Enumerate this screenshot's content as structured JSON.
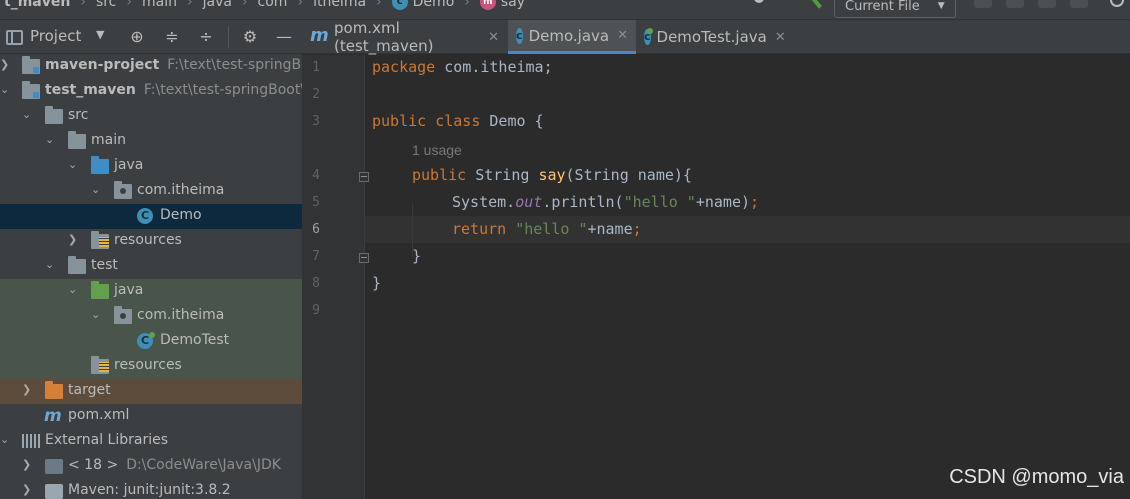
{
  "breadcrumb": {
    "items": [
      "t_maven",
      "src",
      "main",
      "java",
      "com",
      "itheima",
      "Demo",
      "say"
    ],
    "class_icon_letter": "c",
    "method_icon_letter": "m"
  },
  "toolbar": {
    "run_config_label": "Current File",
    "icons": [
      "user-icon",
      "hammer-icon",
      "run-icon",
      "debug-icon",
      "coverage-icon",
      "profile-icon",
      "search-icon"
    ]
  },
  "project_panel": {
    "title": "Project",
    "header_icons": [
      "target-icon",
      "expand-all-icon",
      "collapse-all-icon",
      "gear-icon",
      "minimize-icon"
    ],
    "tree": [
      {
        "label": "maven-project",
        "path": "F:\\text\\test-springBoot",
        "bold": true
      },
      {
        "label": "test_maven",
        "path": "F:\\text\\test-springBoot\\te",
        "bold": true
      },
      {
        "label": "src"
      },
      {
        "label": "main"
      },
      {
        "label": "java"
      },
      {
        "label": "com.itheima"
      },
      {
        "label": "Demo",
        "icon_letter": "C"
      },
      {
        "label": "resources"
      },
      {
        "label": "test"
      },
      {
        "label": "java"
      },
      {
        "label": "com.itheima"
      },
      {
        "label": "DemoTest",
        "icon_letter": "C"
      },
      {
        "label": "resources"
      },
      {
        "label": "target"
      },
      {
        "label": "pom.xml",
        "icon_letter": "m"
      },
      {
        "label": "External Libraries"
      },
      {
        "label": "< 18 >",
        "path": "D:\\CodeWare\\Java\\JDK"
      },
      {
        "label": "Maven: junit:junit:3.8.2"
      }
    ]
  },
  "tabs": [
    {
      "label": "pom.xml (test_maven)",
      "icon_letter": "m",
      "close": "✕"
    },
    {
      "label": "Demo.java",
      "icon_letter": "c",
      "close": "✕",
      "active": true
    },
    {
      "label": "DemoTest.java",
      "icon_letter": "c",
      "close": "✕"
    }
  ],
  "editor": {
    "line_numbers": [
      "1",
      "2",
      "3",
      "4",
      "5",
      "6",
      "7",
      "8",
      "9"
    ],
    "current_line": "6",
    "inlay_hint": "1 usage",
    "code": {
      "l1_kw": "package",
      "l1_rest": " com.itheima;",
      "l3_kw": "public class",
      "l3_rest": " Demo {",
      "l4_kw": "public",
      "l4_type": " String ",
      "l4_fn": "say",
      "l4_rest": "(String name){",
      "l5_a": "System.",
      "l5_fld": "out",
      "l5_b": ".println(",
      "l5_str": "\"hello \"",
      "l5_c": "+name)",
      "l5_semi": ";",
      "l6_kw": "return",
      "l6_str": " \"hello \"",
      "l6_rest": "+name",
      "l6_semi": ";",
      "l7": "}",
      "l8": "}"
    }
  },
  "watermark": "CSDN @momo_via",
  "colors": {
    "keyword": "#cc7832",
    "function": "#ffc66d",
    "string": "#6a8759",
    "field": "#9876aa",
    "plain": "#a9b7c6",
    "selection": "#0d293e"
  }
}
